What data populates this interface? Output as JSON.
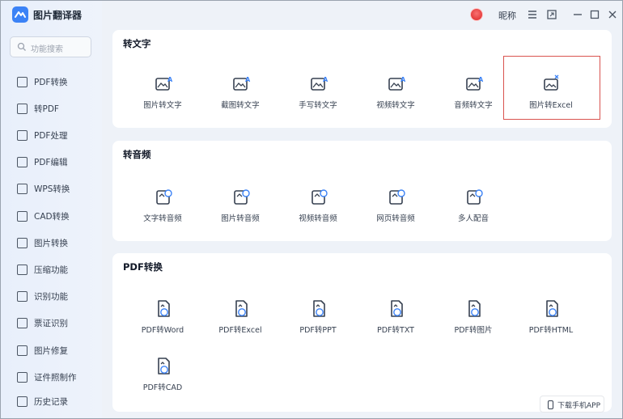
{
  "app": {
    "title": "图片翻译器",
    "nickname": "昵称"
  },
  "titlebar_icons": [
    "menu-icon",
    "resize-icon",
    "minimize-icon",
    "maximize-icon",
    "close-icon"
  ],
  "search": {
    "placeholder": "功能搜索"
  },
  "sidebar": {
    "items": [
      {
        "label": "PDF转换",
        "icon": "pdf-convert-icon"
      },
      {
        "label": "转PDF",
        "icon": "to-pdf-icon"
      },
      {
        "label": "PDF处理",
        "icon": "pdf-process-icon"
      },
      {
        "label": "PDF编辑",
        "icon": "pdf-edit-icon"
      },
      {
        "label": "WPS转换",
        "icon": "wps-convert-icon"
      },
      {
        "label": "CAD转换",
        "icon": "cad-convert-icon"
      },
      {
        "label": "图片转换",
        "icon": "image-convert-icon"
      },
      {
        "label": "压缩功能",
        "icon": "compress-icon"
      },
      {
        "label": "识别功能",
        "icon": "recognize-icon"
      },
      {
        "label": "票证识别",
        "icon": "ticket-icon"
      },
      {
        "label": "图片修复",
        "icon": "image-repair-icon"
      },
      {
        "label": "证件照制作",
        "icon": "id-photo-icon"
      },
      {
        "label": "历史记录",
        "icon": "history-icon"
      }
    ]
  },
  "sections": [
    {
      "title": "转文字",
      "items": [
        {
          "label": "图片转文字",
          "icon": "image-to-text-icon"
        },
        {
          "label": "截图转文字",
          "icon": "screenshot-to-text-icon"
        },
        {
          "label": "手写转文字",
          "icon": "handwriting-to-text-icon"
        },
        {
          "label": "视频转文字",
          "icon": "video-to-text-icon"
        },
        {
          "label": "音频转文字",
          "icon": "audio-to-text-icon"
        },
        {
          "label": "图片转Excel",
          "icon": "image-to-excel-icon",
          "highlighted": true
        }
      ]
    },
    {
      "title": "转音频",
      "items": [
        {
          "label": "文字转音频",
          "icon": "text-to-audio-icon"
        },
        {
          "label": "图片转音频",
          "icon": "image-to-audio-icon"
        },
        {
          "label": "视频转音频",
          "icon": "video-to-audio-icon"
        },
        {
          "label": "网页转音频",
          "icon": "webpage-to-audio-icon"
        },
        {
          "label": "多人配音",
          "icon": "multi-voice-icon"
        }
      ]
    },
    {
      "title": "PDF转换",
      "items": [
        {
          "label": "PDF转Word",
          "icon": "pdf-to-word-icon"
        },
        {
          "label": "PDF转Excel",
          "icon": "pdf-to-excel-icon"
        },
        {
          "label": "PDF转PPT",
          "icon": "pdf-to-ppt-icon"
        },
        {
          "label": "PDF转TXT",
          "icon": "pdf-to-txt-icon"
        },
        {
          "label": "PDF转图片",
          "icon": "pdf-to-image-icon"
        },
        {
          "label": "PDF转HTML",
          "icon": "pdf-to-html-icon"
        },
        {
          "label": "PDF转CAD",
          "icon": "pdf-to-cad-icon"
        }
      ]
    }
  ],
  "download": {
    "label": "下载手机APP"
  },
  "colors": {
    "accent": "#3b82f6",
    "highlight": "#d9534f"
  }
}
